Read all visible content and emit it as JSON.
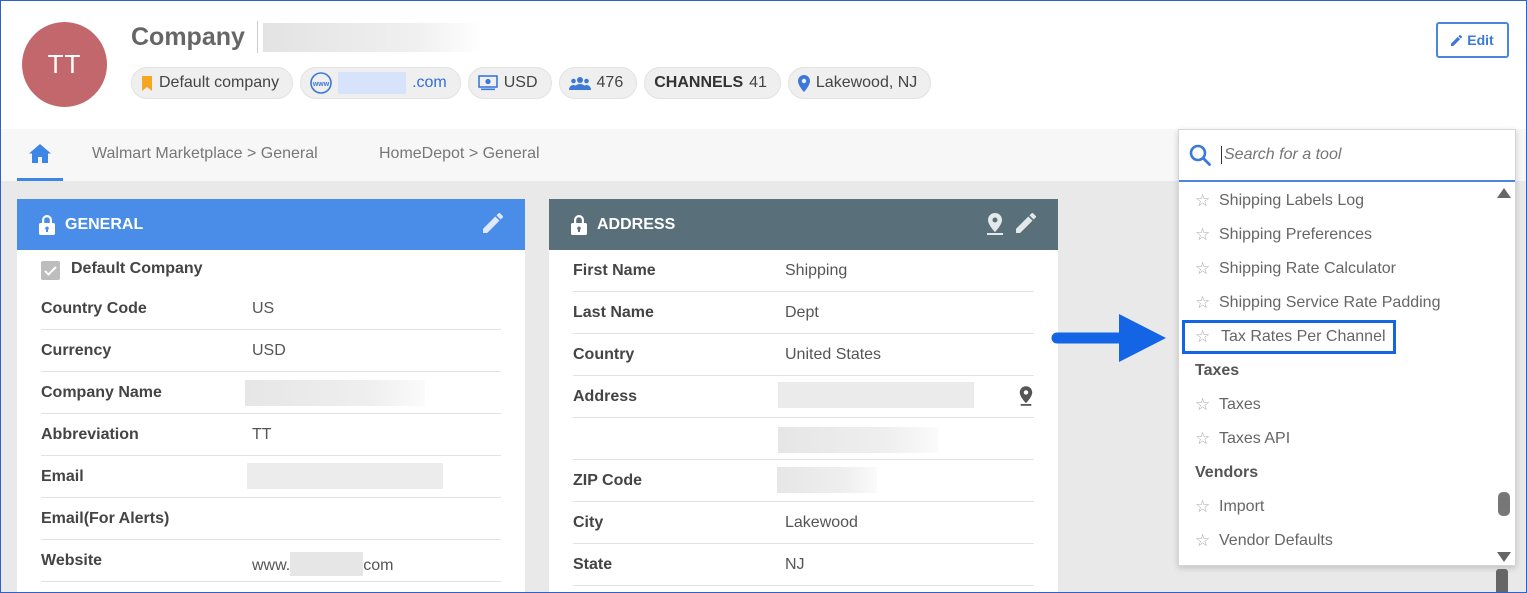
{
  "header": {
    "avatar_initials": "TT",
    "title": "Company",
    "edit_label": "Edit",
    "chips": {
      "default_company": "Default company",
      "website_suffix": ".com",
      "currency": "USD",
      "users_count": "476",
      "channels_label": "CHANNELS",
      "channels_count": "41",
      "location": "Lakewood, NJ"
    }
  },
  "tabs": [
    {
      "label": "Walmart Marketplace > General"
    },
    {
      "label": "HomeDepot > General"
    }
  ],
  "general": {
    "title": "GENERAL",
    "default_company_label": "Default Company",
    "rows": [
      {
        "label": "Country Code",
        "value": "US"
      },
      {
        "label": "Currency",
        "value": "USD"
      },
      {
        "label": "Company Name",
        "value": ""
      },
      {
        "label": "Abbreviation",
        "value": "TT"
      },
      {
        "label": "Email",
        "value": ""
      },
      {
        "label": "Email(For Alerts)",
        "value": ""
      },
      {
        "label": "Website",
        "value_prefix": "www.",
        "value_suffix": "com"
      }
    ]
  },
  "address": {
    "title": "ADDRESS",
    "rows": [
      {
        "label": "First Name",
        "value": "Shipping"
      },
      {
        "label": "Last Name",
        "value": "Dept"
      },
      {
        "label": "Country",
        "value": "United States"
      },
      {
        "label": "Address",
        "value": ""
      },
      {
        "label": "",
        "value": ""
      },
      {
        "label": "ZIP Code",
        "value": ""
      },
      {
        "label": "City",
        "value": "Lakewood"
      },
      {
        "label": "State",
        "value": "NJ"
      }
    ]
  },
  "tool_search": {
    "placeholder": "Search for a tool",
    "items": [
      {
        "type": "item",
        "label": "Shipping Labels Log"
      },
      {
        "type": "item",
        "label": "Shipping Preferences"
      },
      {
        "type": "item",
        "label": "Shipping Rate Calculator"
      },
      {
        "type": "item",
        "label": "Shipping Service Rate Padding"
      },
      {
        "type": "item",
        "label": "Tax Rates Per Channel",
        "highlighted": true
      },
      {
        "type": "group",
        "label": "Taxes"
      },
      {
        "type": "item",
        "label": "Taxes"
      },
      {
        "type": "item",
        "label": "Taxes API"
      },
      {
        "type": "group",
        "label": "Vendors"
      },
      {
        "type": "item",
        "label": "Import"
      },
      {
        "type": "item",
        "label": "Vendor Defaults"
      }
    ]
  },
  "colors": {
    "general_header": "#4a8de8",
    "address_header": "#59707b",
    "avatar": "#c2686d",
    "highlight": "#1464e6",
    "arrow": "#1464e6"
  },
  "icons": [
    "home-icon",
    "lock-icon",
    "pencil-icon",
    "map-pin-icon",
    "search-icon",
    "star-icon",
    "bookmark-icon",
    "globe-icon",
    "money-icon",
    "users-icon",
    "arrow-right-icon"
  ]
}
